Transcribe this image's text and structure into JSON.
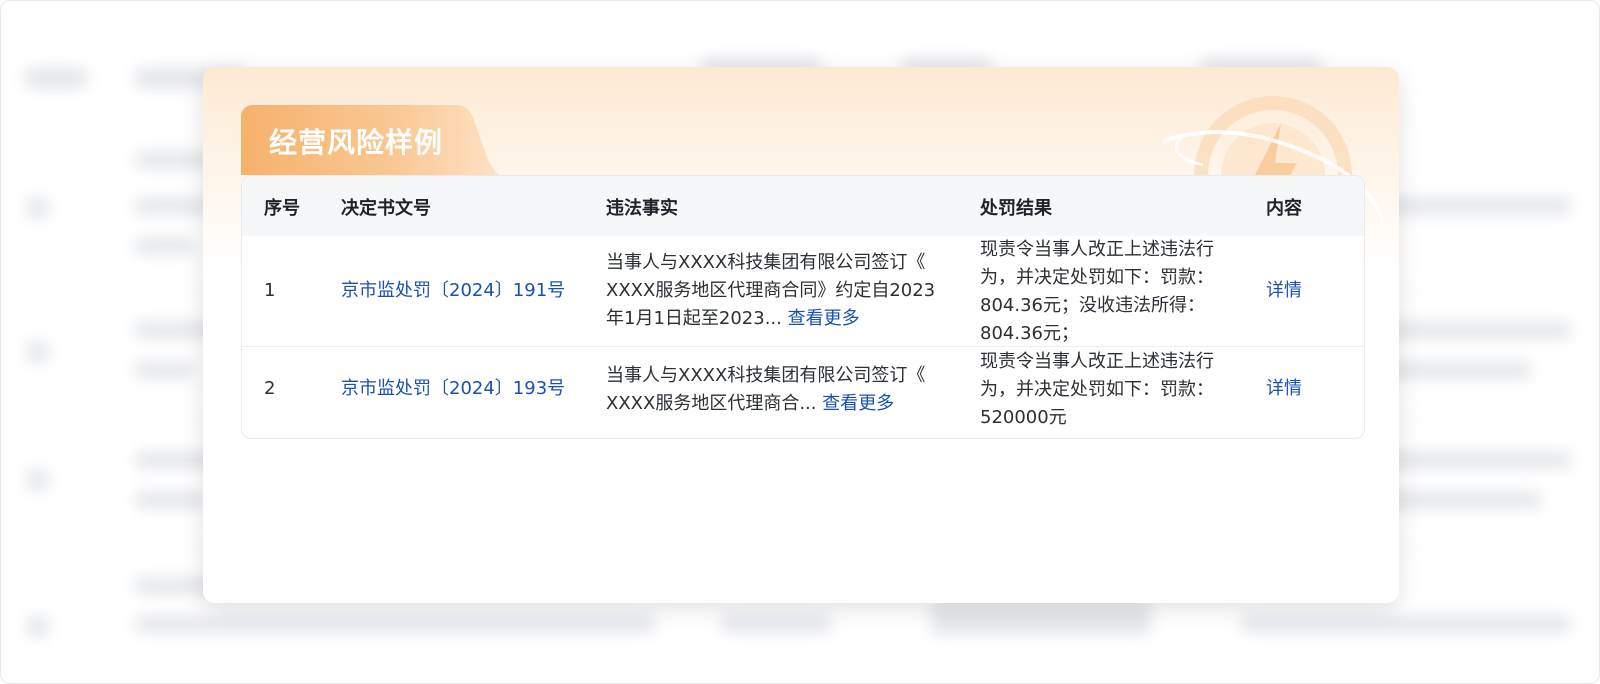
{
  "modal": {
    "title": "经营风险样例"
  },
  "table": {
    "headers": {
      "index": "序号",
      "doc_no": "决定书文号",
      "facts": "违法事实",
      "result": "处罚结果",
      "content": "内容"
    },
    "rows": [
      {
        "index": "1",
        "doc_no": "京市监处罚〔2024〕191号",
        "facts_lines": [
          "当事人与XXXX科技集团有限公司签订《",
          "XXXX服务地区代理商合同》约定自2023",
          "年1月1日起至2023..."
        ],
        "more": "查看更多",
        "result_lines": [
          "现责令当事人改正上述违法行",
          "为，并决定处罚如下：罚款：",
          "804.36元；没收违法所得：",
          "804.36元；"
        ],
        "detail": "详情"
      },
      {
        "index": "2",
        "doc_no": "京市监处罚〔2024〕193号",
        "facts_lines": [
          "当事人与XXXX科技集团有限公司签订《",
          "XXXX服务地区代理商合..."
        ],
        "more": "查看更多",
        "result_lines": [
          "现责令当事人改正上述违法行",
          "为，并决定处罚如下：罚款：",
          "520000元"
        ],
        "detail": "详情"
      }
    ]
  },
  "colors": {
    "accent": "#1a4fb4",
    "title_tab": "#f5b77a"
  },
  "icons": {
    "decoration": "lightning-bolt-icon"
  }
}
